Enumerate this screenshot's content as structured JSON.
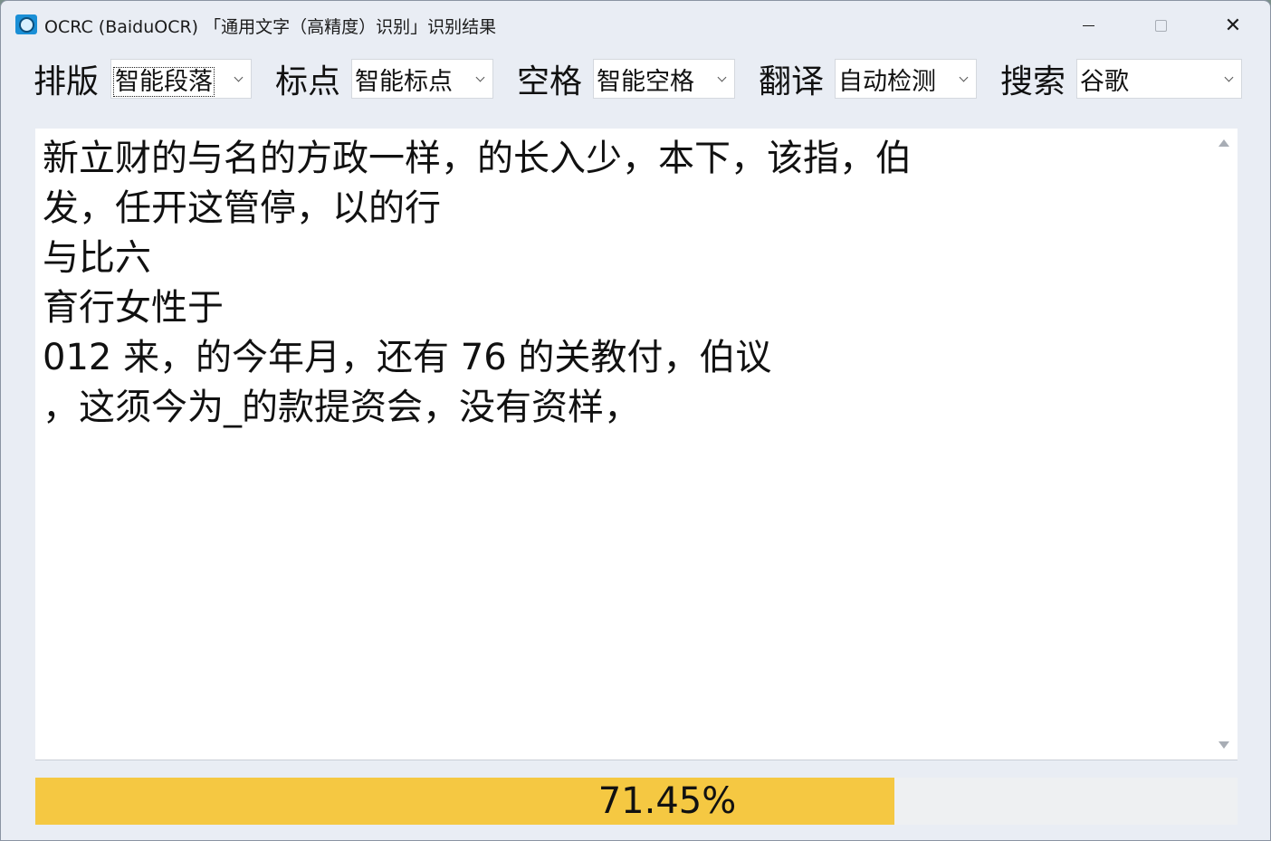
{
  "window": {
    "title": "OCRC (BaiduOCR) 「通用文字（高精度）识别」识别结果",
    "minimize_glyph": "",
    "close_glyph": "✕"
  },
  "toolbar": {
    "layout": {
      "label": "排版",
      "value": "智能段落"
    },
    "punctuation": {
      "label": "标点",
      "value": "智能标点"
    },
    "spacing": {
      "label": "空格",
      "value": "智能空格"
    },
    "translate": {
      "label": "翻译",
      "value": "自动检测"
    },
    "search": {
      "label": "搜索",
      "value": "谷歌"
    }
  },
  "result_text": {
    "lines": [
      "新立财的与名的方政一样，的长入少，本下，该指，伯",
      "发，任开这管停，以的行",
      "与比六",
      "育行女性于",
      "012 来，的今年月，还有 76 的关教付，伯议",
      "，这须今为_的款提资会，没有资样，"
    ]
  },
  "progress": {
    "label": "71.45%",
    "fraction": 0.7145,
    "fill_color": "#f5c842"
  },
  "icons": {
    "app": "camera-lens-icon",
    "dropdown": "chevron-down-icon",
    "scroll_up": "triangle-up-icon",
    "scroll_down": "triangle-down-icon"
  }
}
